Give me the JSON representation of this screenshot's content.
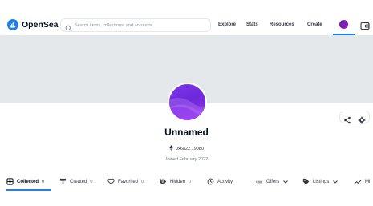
{
  "header": {
    "brand": "OpenSea",
    "search_placeholder": "Search items, collections, and accounts",
    "nav": [
      "Explore",
      "Stats",
      "Resources",
      "Create"
    ]
  },
  "profile": {
    "name": "Unnamed",
    "address": "0x6a22...9080",
    "joined": "Joined February 2022"
  },
  "tabs": [
    {
      "label": "Collected",
      "count": "0",
      "icon": "collected-icon"
    },
    {
      "label": "Created",
      "count": "0",
      "icon": "paintbrush-icon"
    },
    {
      "label": "Favorited",
      "count": "0",
      "icon": "heart-icon"
    },
    {
      "label": "Hidden",
      "count": "0",
      "icon": "eye-off-icon"
    },
    {
      "label": "Activity",
      "icon": "clock-icon"
    },
    {
      "label": "Offers",
      "icon": "offers-icon"
    },
    {
      "label": "Listings",
      "icon": "tag-icon"
    },
    {
      "label": "Mi",
      "icon": "trend-icon"
    }
  ],
  "colors": {
    "accent": "#2081e2",
    "banner": "#e5e8eb",
    "avatar_gradient_start": "#7c3aed",
    "avatar_gradient_end": "#9333ea"
  }
}
